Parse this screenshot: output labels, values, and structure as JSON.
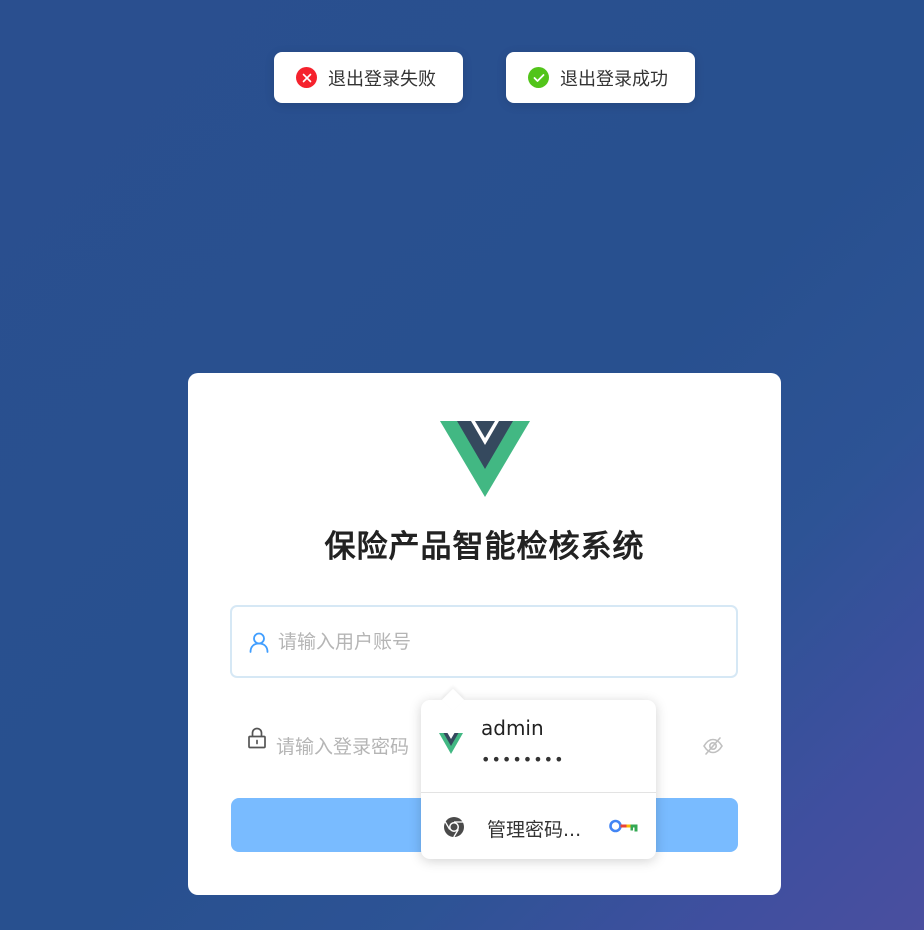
{
  "toasts": {
    "error_text": "退出登录失败",
    "success_text": "退出登录成功"
  },
  "login": {
    "title": "保险产品智能检核系统",
    "username_placeholder": "请输入用户账号",
    "password_placeholder": "请输入登录密码",
    "button_label": ""
  },
  "autofill": {
    "username": "admin",
    "password_mask": "••••••••",
    "manage_label": "管理密码..."
  },
  "colors": {
    "accent": "#409eff",
    "button": "#79bbff",
    "error": "#f5222d",
    "success": "#52c41a",
    "vue_green": "#42b883",
    "vue_dark": "#35495e"
  },
  "icons": {
    "error": "error-circle-icon",
    "success": "check-circle-icon",
    "user": "user-icon",
    "lock": "lock-icon",
    "eye": "eye-off-icon",
    "chrome": "chrome-icon",
    "key": "key-icon"
  }
}
